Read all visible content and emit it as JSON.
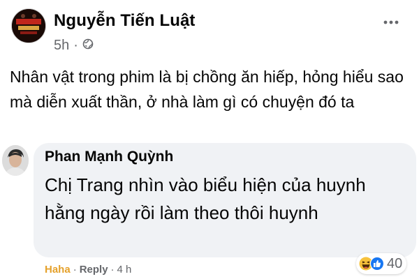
{
  "post": {
    "author": "Nguyễn Tiến Luật",
    "time": "5h",
    "privacy_icon": "globe-icon",
    "text": "Nhân vật trong phim là bị chồng ăn hiếp, hỏng hiểu sao mà diễn xuất thần, ở nhà làm gì có chuyện đó ta"
  },
  "comment": {
    "author": "Phan Mạnh Quỳnh",
    "text": "Chị Trang nhìn vào biểu hiện của huynh hằng ngày rồi làm theo thôi huynh",
    "reaction_label": "Haha",
    "reply_label": "Reply",
    "separator": "·",
    "time": "4 h",
    "reaction_count": "40",
    "reaction_icons": [
      "haha-icon",
      "like-icon"
    ]
  },
  "colors": {
    "secondary_text": "#65676b",
    "bubble_bg": "#f0f2f5",
    "haha_active": "#e5a12b",
    "like_blue": "#1877f2"
  }
}
